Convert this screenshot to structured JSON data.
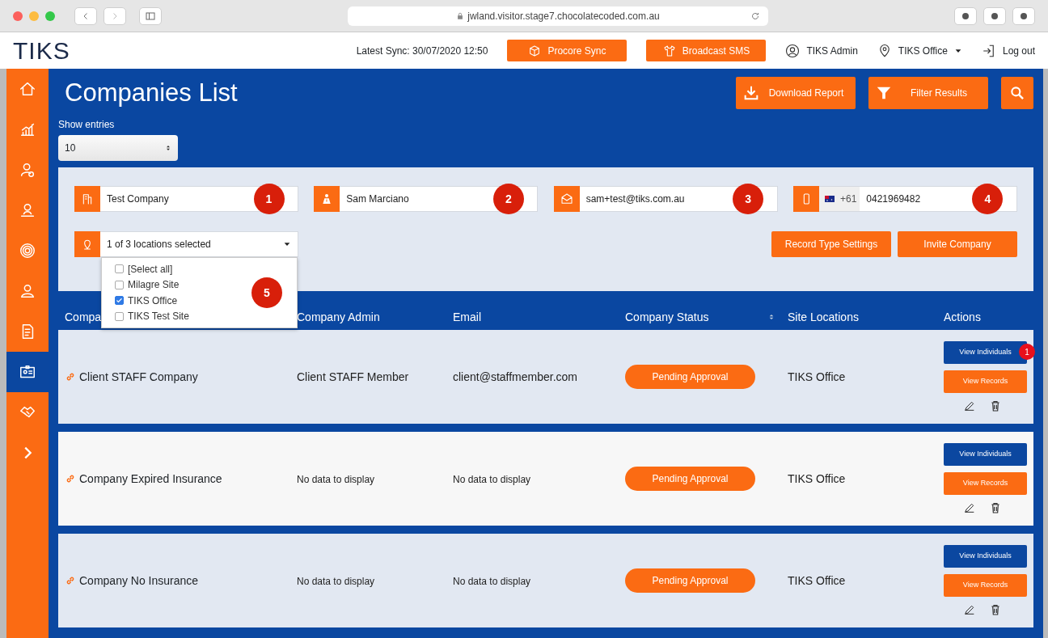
{
  "browser": {
    "url": "jwland.visitor.stage7.chocolatecoded.com.au"
  },
  "header": {
    "logo": "TIKS",
    "sync": "Latest Sync: 30/07/2020 12:50",
    "buttons": [
      "Procore Sync",
      "Broadcast SMS"
    ],
    "user": "TIKS Admin",
    "location": "TIKS Office",
    "logout": "Log out"
  },
  "sidebar": {
    "items": [
      {
        "selected": false
      },
      {
        "selected": false
      },
      {
        "selected": false
      },
      {
        "selected": false
      },
      {
        "selected": false
      },
      {
        "selected": false
      },
      {
        "selected": false
      },
      {
        "selected": true
      },
      {
        "selected": false
      },
      {
        "selected": false
      }
    ]
  },
  "page": {
    "title": "Companies List",
    "actions": [
      "Download Report",
      "Filter Results"
    ]
  },
  "show_entries": {
    "label": "Show entries",
    "value": "10"
  },
  "filters": {
    "fields": [
      {
        "kind": "text",
        "value": "Test Company",
        "marker": "1"
      },
      {
        "kind": "text",
        "value": "Sam Marciano",
        "marker": "2"
      },
      {
        "kind": "text",
        "value": "sam+test@tiks.com.au",
        "marker": "3"
      },
      {
        "kind": "phone",
        "country_code": "+61",
        "value": "0421969482",
        "marker": "4"
      }
    ],
    "location": {
      "value": "1 of 3 locations selected",
      "marker": "5",
      "options": [
        {
          "label": "[Select all]",
          "checked": false
        },
        {
          "label": "Milagre Site",
          "checked": false
        },
        {
          "label": "TIKS Office",
          "checked": true
        },
        {
          "label": "TIKS Test Site",
          "checked": false
        }
      ]
    },
    "buttons": [
      "Record Type Settings",
      "Invite Company"
    ]
  },
  "table": {
    "columns": [
      "Compa",
      "Company Admin",
      "Email",
      "Company Status",
      "Site Locations",
      "Actions"
    ],
    "rows": [
      {
        "company": "Client STAFF Company",
        "admin": "Client STAFF Member",
        "admin_empty": false,
        "email": "client@staffmember.com",
        "email_empty": false,
        "status": "Pending Approval",
        "site": "TIKS Office",
        "actions": [
          "View Individuals",
          "View Records"
        ],
        "badge": "1"
      },
      {
        "company": "Company Expired Insurance",
        "admin": "No data to display",
        "admin_empty": true,
        "email": "No data to display",
        "email_empty": true,
        "status": "Pending Approval",
        "site": "TIKS Office",
        "actions": [
          "View Individuals",
          "View Records"
        ]
      },
      {
        "company": "Company No Insurance",
        "admin": "No data to display",
        "admin_empty": true,
        "email": "No data to display",
        "email_empty": true,
        "status": "Pending Approval",
        "site": "TIKS Office",
        "actions": [
          "View Individuals",
          "View Records"
        ]
      }
    ]
  }
}
